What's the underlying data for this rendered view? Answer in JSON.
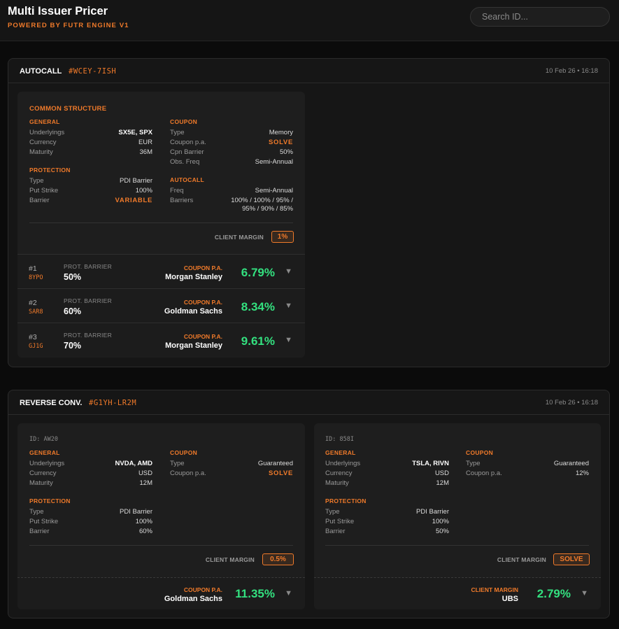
{
  "app": {
    "title": "Multi Issuer Pricer",
    "subtitle": "POWERED BY FUTR ENGINE V1",
    "search_placeholder": "Search ID..."
  },
  "autocall": {
    "type": "AUTOCALL",
    "id": "#WCEY-7ISH",
    "date": "10 Feb 26 • 16:18",
    "common_title": "COMMON STRUCTURE",
    "general": {
      "title": "GENERAL",
      "underlyings_label": "Underlyings",
      "underlyings": "SX5E, SPX",
      "currency_label": "Currency",
      "currency": "EUR",
      "maturity_label": "Maturity",
      "maturity": "36M"
    },
    "protection": {
      "title": "PROTECTION",
      "type_label": "Type",
      "type": "PDI Barrier",
      "put_strike_label": "Put Strike",
      "put_strike": "100%",
      "barrier_label": "Barrier",
      "barrier": "VARIABLE"
    },
    "coupon": {
      "title": "COUPON",
      "type_label": "Type",
      "type": "Memory",
      "coupon_pa_label": "Coupon p.a.",
      "coupon_pa": "SOLVE",
      "cpn_barrier_label": "Cpn Barrier",
      "cpn_barrier": "50%",
      "obs_freq_label": "Obs. Freq",
      "obs_freq": "Semi-Annual"
    },
    "autocall_group": {
      "title": "AUTOCALL",
      "freq_label": "Freq",
      "freq": "Semi-Annual",
      "barriers_label": "Barriers",
      "barriers_line1": "100% / 100% / 95% /",
      "barriers_line2": "95% / 90% / 85%"
    },
    "client_margin_label": "CLIENT MARGIN",
    "client_margin": "1%",
    "results": [
      {
        "num": "#1",
        "code": "8YPO",
        "prot_label": "PROT. BARRIER",
        "prot": "50%",
        "coupon_label": "COUPON P.A.",
        "issuer": "Morgan Stanley",
        "rate": "6.79%"
      },
      {
        "num": "#2",
        "code": "SAR8",
        "prot_label": "PROT. BARRIER",
        "prot": "60%",
        "coupon_label": "COUPON P.A.",
        "issuer": "Goldman Sachs",
        "rate": "8.34%"
      },
      {
        "num": "#3",
        "code": "GJ1G",
        "prot_label": "PROT. BARRIER",
        "prot": "70%",
        "coupon_label": "COUPON P.A.",
        "issuer": "Morgan Stanley",
        "rate": "9.61%"
      }
    ]
  },
  "reverse": {
    "type": "REVERSE CONV.",
    "id": "#G1YH-LR2M",
    "date": "10 Feb 26 • 16:18",
    "cards": [
      {
        "id_label": "ID: AW20",
        "general": {
          "title": "GENERAL",
          "underlyings_label": "Underlyings",
          "underlyings": "NVDA, AMD",
          "currency_label": "Currency",
          "currency": "USD",
          "maturity_label": "Maturity",
          "maturity": "12M"
        },
        "protection": {
          "title": "PROTECTION",
          "type_label": "Type",
          "type": "PDI Barrier",
          "put_strike_label": "Put Strike",
          "put_strike": "100%",
          "barrier_label": "Barrier",
          "barrier": "60%"
        },
        "coupon": {
          "title": "COUPON",
          "type_label": "Type",
          "type": "Guaranteed",
          "coupon_pa_label": "Coupon p.a.",
          "coupon_pa": "SOLVE"
        },
        "client_margin_label": "CLIENT MARGIN",
        "client_margin": "0.5%",
        "result": {
          "label": "COUPON P.A.",
          "issuer": "Goldman Sachs",
          "rate": "11.35%"
        }
      },
      {
        "id_label": "ID: 858I",
        "general": {
          "title": "GENERAL",
          "underlyings_label": "Underlyings",
          "underlyings": "TSLA, RIVN",
          "currency_label": "Currency",
          "currency": "USD",
          "maturity_label": "Maturity",
          "maturity": "12M"
        },
        "protection": {
          "title": "PROTECTION",
          "type_label": "Type",
          "type": "PDI Barrier",
          "put_strike_label": "Put Strike",
          "put_strike": "100%",
          "barrier_label": "Barrier",
          "barrier": "50%"
        },
        "coupon": {
          "title": "COUPON",
          "type_label": "Type",
          "type": "Guaranteed",
          "coupon_pa_label": "Coupon p.a.",
          "coupon_pa": "12%"
        },
        "client_margin_label": "CLIENT MARGIN",
        "client_margin": "SOLVE",
        "result": {
          "label": "CLIENT MARGIN",
          "issuer": "UBS",
          "rate": "2.79%"
        }
      }
    ]
  },
  "colors": {
    "accent": "#f07a2a",
    "positive": "#33e07f",
    "background": "#0b0b0b"
  },
  "icons": {
    "expand": "chevron-down-icon"
  }
}
